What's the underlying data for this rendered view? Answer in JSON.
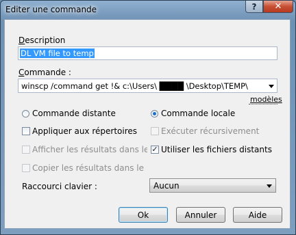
{
  "window": {
    "title": "Editer une commande"
  },
  "titlebar": {
    "help_glyph": "?",
    "close_glyph": "✕"
  },
  "form": {
    "description_label": "Description",
    "description_value": "DL VM file to temp",
    "command_label": "Commande :",
    "command_value": "winscp /command get !& c:\\Users\\ ████ \\Desktop\\TEMP\\",
    "patterns_link": "modèles",
    "radio_remote": "Commande distante",
    "radio_local": "Commande locale",
    "radio_selected": "local",
    "chk_apply_dirs": "Appliquer aux répertoires",
    "chk_recursive": "Exécuter récursivement",
    "chk_show_results": "Afficher les résultats dans le termir",
    "chk_use_remote": "Utiliser les fichiers distants",
    "chk_copy_results": "Copier les résultats dans le Presse",
    "shortcut_label": "Raccourci clavier :",
    "shortcut_value": "Aucun"
  },
  "buttons": {
    "ok": "Ok",
    "cancel": "Annuler",
    "help": "Aide"
  },
  "colors": {
    "selection": "#3399ff",
    "titlebar": "#8fb0cf",
    "close": "#c74f33"
  }
}
